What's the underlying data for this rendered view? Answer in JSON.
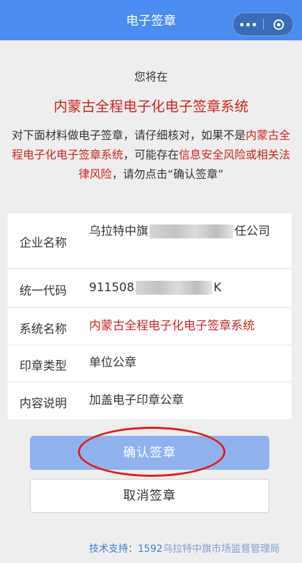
{
  "nav": {
    "title": "电子签章"
  },
  "intro": "您将在",
  "system_title": "内蒙古全程电子化电子签章系统",
  "notice": {
    "part1": "对下面材料做电子签章，请仔细核对，如果不是",
    "highlight1": "内蒙古全程电子化电子签章系统",
    "part2": "，可能存在",
    "highlight2": "信息安全风险或相关法律风险",
    "part3": "，请勿点击“确认签章”"
  },
  "info": {
    "company_label": "企业名称",
    "company_prefix": "乌拉特中旗",
    "company_suffix": "任公司",
    "code_label": "统一代码",
    "code_prefix": "911508",
    "code_suffix": "K",
    "system_label": "系统名称",
    "system_value": "内蒙古全程电子化电子签章系统",
    "seal_type_label": "印章类型",
    "seal_type_value": "单位公章",
    "content_label": "内容说明",
    "content_value": "加盖电子印章公章"
  },
  "buttons": {
    "confirm": "确认签章",
    "cancel": "取消签章"
  },
  "footer": {
    "support": "技术支持：1592",
    "watermark": "乌拉特中旗市场监督管理局"
  },
  "colors": {
    "nav_bg": "#4a8cf0",
    "accent_red": "#d0231e",
    "confirm_bg": "#8fb2ef",
    "annotation_red": "#e21b1b"
  }
}
